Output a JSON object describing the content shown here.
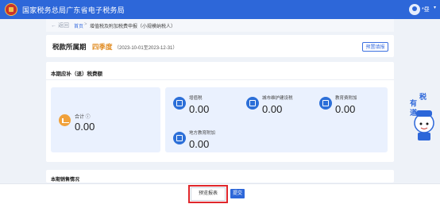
{
  "header": {
    "title": "国家税务总局广东省电子税务局",
    "user_name": "*昼",
    "user_caret": "▾"
  },
  "breadcrumb": {
    "back": "← 返回",
    "home": "首页",
    "separator": ">",
    "current": "增值税及附加税费申报（小规模纳税人）"
  },
  "period": {
    "label": "税款所属期",
    "quarter": "四季度",
    "range": "（2023-10-01至2023-12-31）",
    "modify_button": "预置填报"
  },
  "tax_section": {
    "title": "本期应补（退）税费额",
    "total": {
      "label": "合计 ⓘ",
      "value": "0.00"
    },
    "items": [
      {
        "label": "增值税",
        "value": "0.00",
        "icon": "receipt-icon"
      },
      {
        "label": "城市维护建设税",
        "value": "0.00",
        "icon": "building-icon"
      },
      {
        "label": "教育费附加",
        "value": "0.00",
        "icon": "graduation-cap-icon"
      },
      {
        "label": "地方教育附加",
        "value": "0.00",
        "icon": "book-icon"
      }
    ]
  },
  "section2": {
    "title": "本期销售情况"
  },
  "footer": {
    "preview_button": "预览报表",
    "submit_button": "提交"
  },
  "mascot": {
    "line1": "税",
    "line2": "有",
    "line3": "道"
  },
  "colors": {
    "primary": "#2d67d9",
    "accent_orange": "#e08a1e",
    "highlight_red": "#e0262b",
    "panel_blue": "#eaf1fe"
  }
}
